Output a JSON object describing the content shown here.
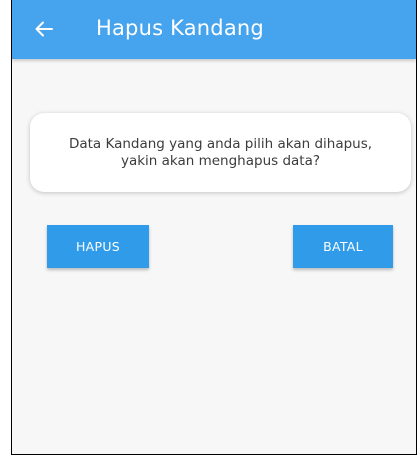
{
  "app_bar": {
    "title": "Hapus Kandang",
    "back_icon": "arrow-left-icon",
    "color": "#46a4ee"
  },
  "dialog": {
    "message": "Data Kandang yang anda pilih akan dihapus, yakin akan menghapus data?"
  },
  "actions": {
    "delete_label": "HAPUS",
    "cancel_label": "BATAL",
    "button_color": "#2f9be9"
  }
}
